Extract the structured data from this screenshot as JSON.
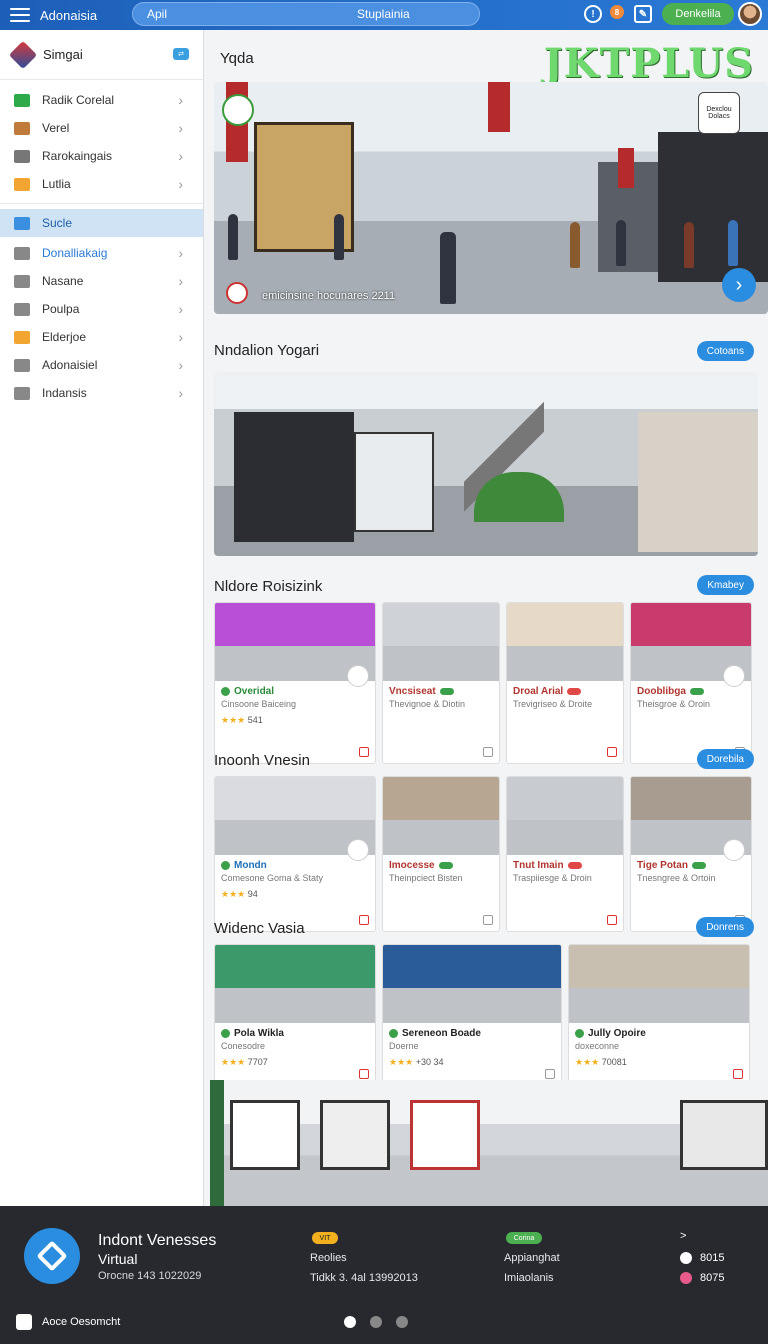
{
  "topbar": {
    "app_title": "Adonaisia",
    "search_left": "Apil",
    "search_center": "Stuplainia",
    "notif_count": "8",
    "pill": "Denkelila"
  },
  "sidebar": {
    "brand": "Simgai",
    "items": [
      {
        "label": "Radik Corelal",
        "color": "#2faa4a"
      },
      {
        "label": "Verel",
        "color": "#c07a3a"
      },
      {
        "label": "Rarokaingais",
        "color": "#777777"
      },
      {
        "label": "Lutlia",
        "color": "#f2a531"
      }
    ],
    "active": {
      "label": "Sucle",
      "color": "#3a8fe0"
    },
    "items2": [
      {
        "label": "Donalliakaig",
        "color": "#888888",
        "highlight": true
      },
      {
        "label": "Nasane",
        "color": "#888888"
      },
      {
        "label": "Poulpa",
        "color": "#888888"
      },
      {
        "label": "Elderjoe",
        "color": "#f2a531"
      },
      {
        "label": "Adonaisiel",
        "color": "#888888"
      },
      {
        "label": "Indansis",
        "color": "#888888"
      }
    ]
  },
  "main": {
    "header": "Yqda",
    "watermark": "JKTPLUS",
    "hero": {
      "caption": "emicinsine hocunares 2211",
      "sign": "Dexclou Dolacs"
    },
    "sections": [
      {
        "title": "Nndalion Yogari",
        "button": "Cotoans"
      },
      {
        "title": "Nldore Roisizink",
        "button": "Kmabey"
      },
      {
        "title": "Inoonh Vnesin",
        "button": "Dorebila"
      },
      {
        "title": "Widenc Vasia",
        "button": "Donrens"
      }
    ],
    "row1": [
      {
        "title": "Overidal",
        "sub": "Cinsoone Baiceing",
        "meta": "541",
        "tag": "",
        "color": "#b94fd6"
      },
      {
        "title": "Vncsiseat",
        "sub": "Thevignoe & Diotin",
        "meta": "",
        "tag": "ok",
        "color": "#cfd2d6"
      },
      {
        "title": "Droal Arial",
        "sub": "Trevigriseo & Droite",
        "meta": "",
        "tag": "ok",
        "color": "#e7d9c8"
      },
      {
        "title": "Dooblibga",
        "sub": "Theisgroe & Oroin",
        "meta": "",
        "tag": "ok",
        "color": "#c93b6c"
      }
    ],
    "row2": [
      {
        "title": "Mondn",
        "sub": "Comesone Goma & Staty",
        "meta": "94",
        "tag": "",
        "color": "#d9dbe0"
      },
      {
        "title": "Imocesse",
        "sub": "Theinpciect Bisten",
        "meta": "",
        "tag": "ok",
        "color": "#b7a792"
      },
      {
        "title": "Tnut Imain",
        "sub": "Traspiiesge & Droin",
        "meta": "",
        "tag": "ok",
        "color": "#c8ccd0"
      },
      {
        "title": "Tige Potan",
        "sub": "Tnesngree & Ortoin",
        "meta": "",
        "tag": "ok",
        "color": "#a79c8f"
      }
    ],
    "row3": [
      {
        "title": "Pola Wikla",
        "sub": "Conesodre",
        "meta": "7707",
        "color": "#3c9a6a"
      },
      {
        "title": "Sereneon Boade",
        "sub": "Doerne",
        "meta": "+30 34",
        "color": "#2a5c9a"
      },
      {
        "title": "Jully Opoire",
        "sub": "doxeconne",
        "meta": "70081",
        "color": "#c9bfb1"
      }
    ]
  },
  "footer": {
    "title1": "Indont Venesses",
    "title2": "Virtual",
    "meta": "Orocne 143 1022029",
    "col1_pill": "VIT",
    "col1_a": "Reolies",
    "col1_b": "Tidkk 3. 4al 13992013",
    "col2_pill": "Corina",
    "col2_a": "Appianghat",
    "col2_b": "Imiaolanis",
    "right_top": ">",
    "right1": "8015",
    "right2": "8075",
    "bottom": "Aoce Oesomcht"
  }
}
